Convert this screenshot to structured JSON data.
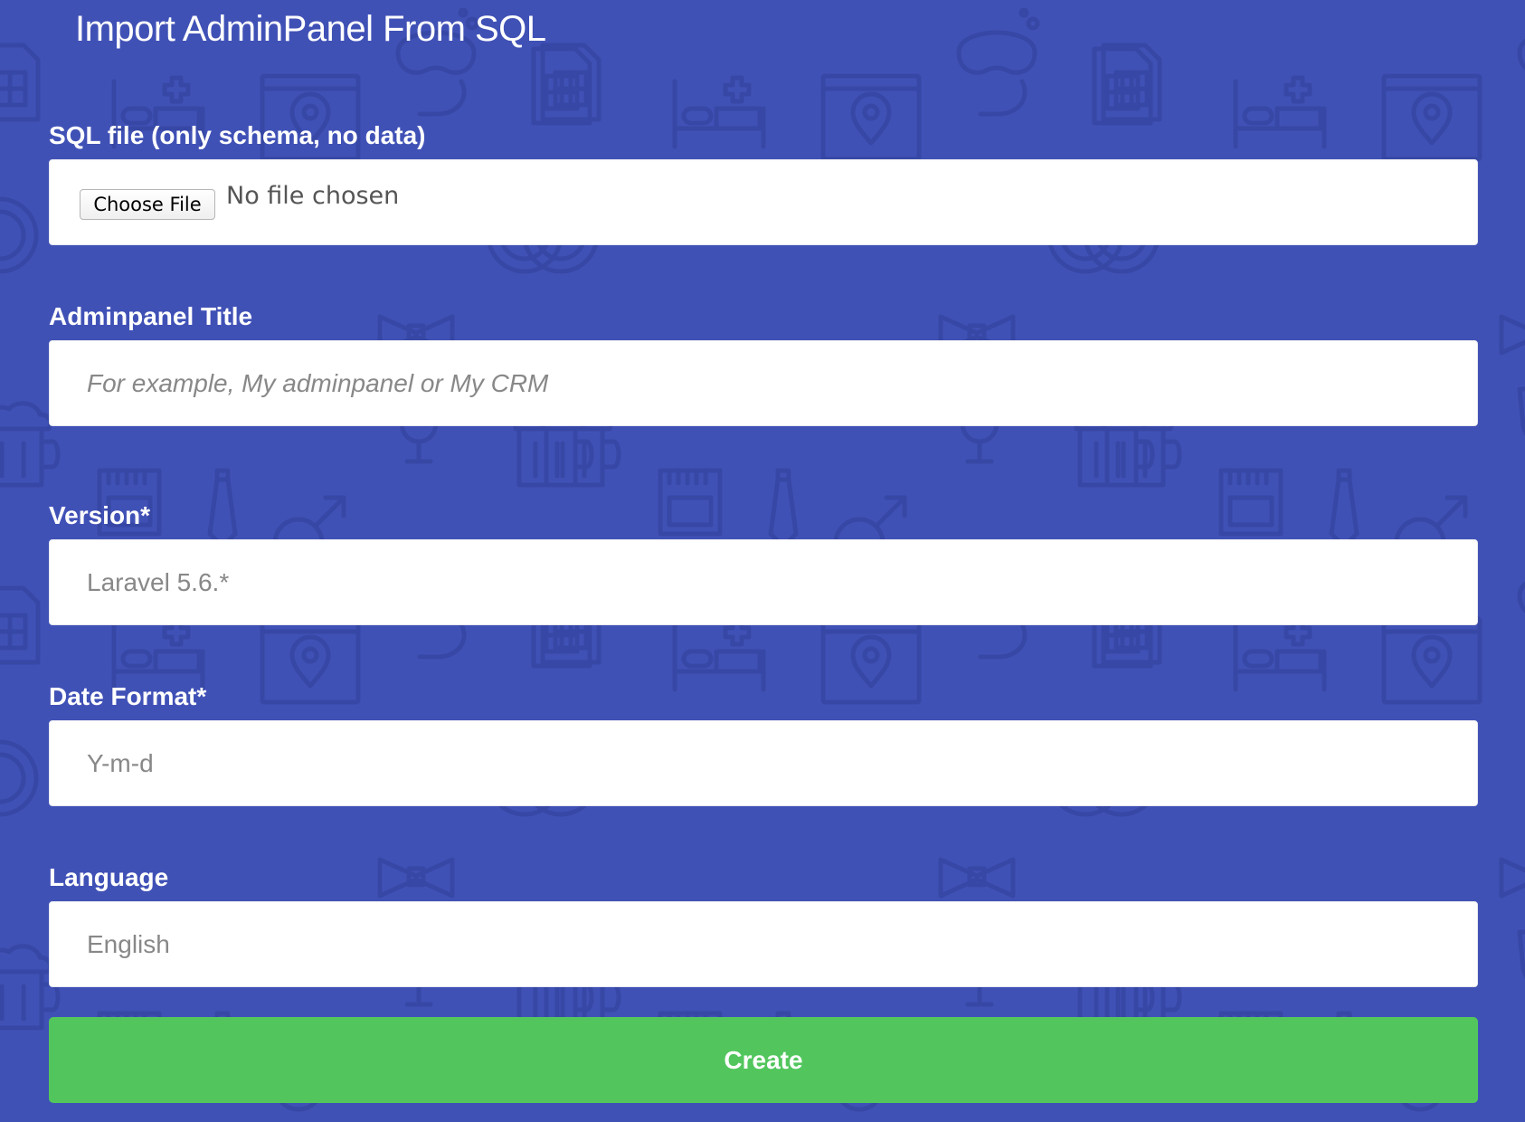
{
  "page": {
    "title": "Import AdminPanel From SQL"
  },
  "form": {
    "sql_file": {
      "label": "SQL file (only schema, no data)",
      "button_label": "Choose File",
      "status": "No file chosen"
    },
    "title": {
      "label": "Adminpanel Title",
      "value": "",
      "placeholder": "For example, My adminpanel or My CRM"
    },
    "version": {
      "label": "Version*",
      "value": "Laravel 5.6.*"
    },
    "date_format": {
      "label": "Date Format*",
      "value": "Y-m-d"
    },
    "language": {
      "label": "Language",
      "value": "English"
    },
    "submit_label": "Create"
  },
  "colors": {
    "background": "#4051b6",
    "pattern_stroke": "#3747a5",
    "submit_button": "#52c65d",
    "label_text": "#ffffff",
    "input_background": "#ffffff"
  },
  "background_icons": [
    "document-icon",
    "bed-icon",
    "map-window-icon",
    "snorkel-mask-icon",
    "sd-card-icon",
    "beer-mug-icon",
    "cocktail-glass-icon",
    "bow-tie-icon",
    "necktie-icon",
    "male-symbol-icon",
    "plate-icon"
  ]
}
